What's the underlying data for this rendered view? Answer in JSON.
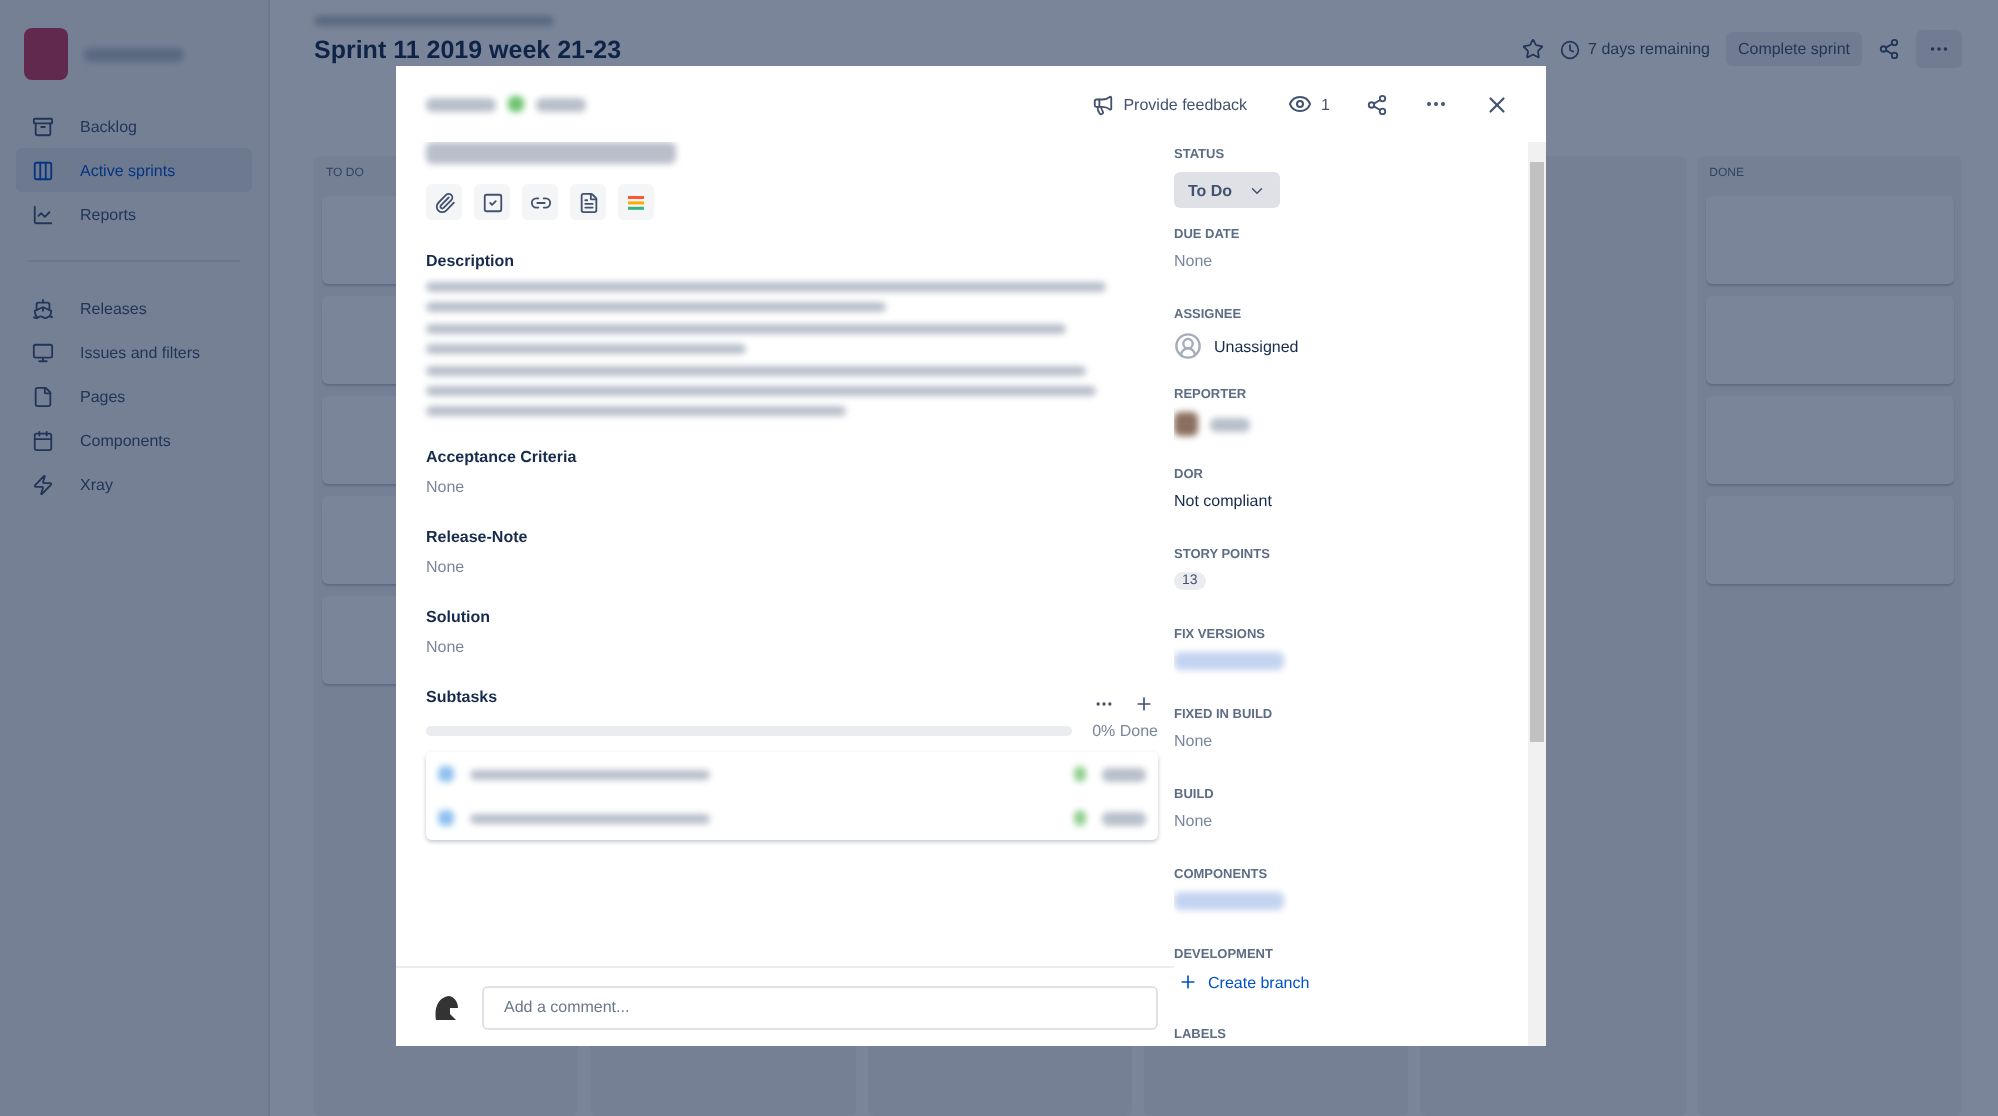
{
  "sidebar": {
    "items": [
      {
        "label": "Backlog",
        "selected": false
      },
      {
        "label": "Active sprints",
        "selected": true
      },
      {
        "label": "Reports",
        "selected": false
      },
      {
        "label": "Releases",
        "selected": false
      },
      {
        "label": "Issues and filters",
        "selected": false
      },
      {
        "label": "Pages",
        "selected": false
      },
      {
        "label": "Components",
        "selected": false
      },
      {
        "label": "Xray",
        "selected": false
      }
    ]
  },
  "header": {
    "title": "Sprint 11 2019 week 21-23",
    "remaining": "7 days remaining",
    "complete_button": "Complete sprint"
  },
  "board": {
    "columns": [
      {
        "title": "TO DO"
      },
      {
        "title": "DONE"
      }
    ]
  },
  "modal": {
    "feedback": "Provide feedback",
    "watchers": "1",
    "sections": [
      {
        "heading": "Description",
        "kind": "blurred"
      },
      {
        "heading": "Acceptance Criteria",
        "kind": "none",
        "value": "None"
      },
      {
        "heading": "Release-Note",
        "kind": "none",
        "value": "None"
      },
      {
        "heading": "Solution",
        "kind": "none",
        "value": "None"
      }
    ],
    "subtasks": {
      "heading": "Subtasks",
      "level": 0,
      "progress": "0% Done"
    },
    "comment": {
      "placeholder": "Add a comment..."
    },
    "fields": [
      {
        "label": "STATUS",
        "kind": "status",
        "value": "To Do"
      },
      {
        "label": "DUE DATE",
        "kind": "none",
        "value": "None"
      },
      {
        "label": "ASSIGNEE",
        "kind": "user",
        "value": "Unassigned"
      },
      {
        "label": "REPORTER",
        "kind": "blurred-user"
      },
      {
        "label": "DOR",
        "kind": "text",
        "value": "Not compliant"
      },
      {
        "label": "STORY POINTS",
        "kind": "badge",
        "value": "13"
      },
      {
        "label": "FIX VERSIONS",
        "kind": "blurred-link"
      },
      {
        "label": "FIXED IN BUILD",
        "kind": "none",
        "value": "None"
      },
      {
        "label": "BUILD",
        "kind": "none",
        "value": "None"
      },
      {
        "label": "COMPONENTS",
        "kind": "blurred-link"
      },
      {
        "label": "DEVELOPMENT",
        "kind": "link",
        "value": "Create branch"
      },
      {
        "label": "LABELS",
        "kind": "empty"
      }
    ]
  }
}
